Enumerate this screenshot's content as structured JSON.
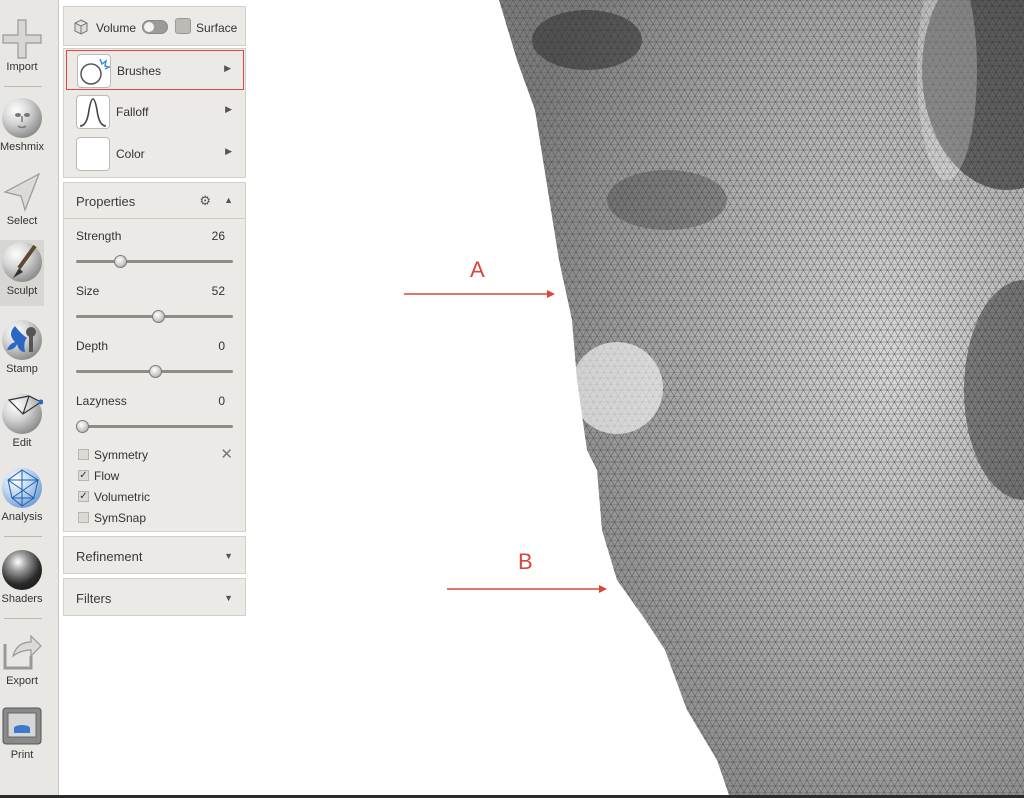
{
  "toolbar": {
    "tools": [
      {
        "label": "Import",
        "icon": "plus-icon"
      },
      {
        "label": "Meshmix",
        "icon": "head-sphere-icon"
      },
      {
        "label": "Select",
        "icon": "cursor-arrow-icon"
      },
      {
        "label": "Sculpt",
        "icon": "brush-sphere-icon",
        "active": true
      },
      {
        "label": "Stamp",
        "icon": "fleur-stamp-icon"
      },
      {
        "label": "Edit",
        "icon": "edit-sphere-icon"
      },
      {
        "label": "Analysis",
        "icon": "mesh-sphere-icon"
      },
      {
        "label": "Shaders",
        "icon": "shader-sphere-icon"
      },
      {
        "label": "Export",
        "icon": "export-arrow-icon"
      },
      {
        "label": "Print",
        "icon": "printer-icon"
      }
    ]
  },
  "panel": {
    "mode": {
      "volume_label": "Volume",
      "surface_label": "Surface"
    },
    "menu": {
      "brushes": "Brushes",
      "falloff": "Falloff",
      "color": "Color"
    },
    "properties": {
      "title": "Properties",
      "strength": {
        "label": "Strength",
        "value": "26"
      },
      "size": {
        "label": "Size",
        "value": "52"
      },
      "depth": {
        "label": "Depth",
        "value": "0"
      },
      "lazyness": {
        "label": "Lazyness",
        "value": "0"
      },
      "checks": {
        "symmetry": {
          "label": "Symmetry",
          "checked": false
        },
        "flow": {
          "label": "Flow",
          "checked": true
        },
        "volumetric": {
          "label": "Volumetric",
          "checked": true
        },
        "symsnap": {
          "label": "SymSnap",
          "checked": false
        }
      },
      "check_mark": "✓"
    },
    "refinement": {
      "title": "Refinement"
    },
    "filters": {
      "title": "Filters"
    }
  },
  "glyphs": {
    "arrow_right": "▶",
    "arrow_up": "▲",
    "arrow_down": "▼",
    "gear": "⚙",
    "wrench": "✕"
  },
  "viewport": {
    "annotations": {
      "a": "A",
      "b": "B"
    },
    "annotation_color": "#d9463a"
  }
}
